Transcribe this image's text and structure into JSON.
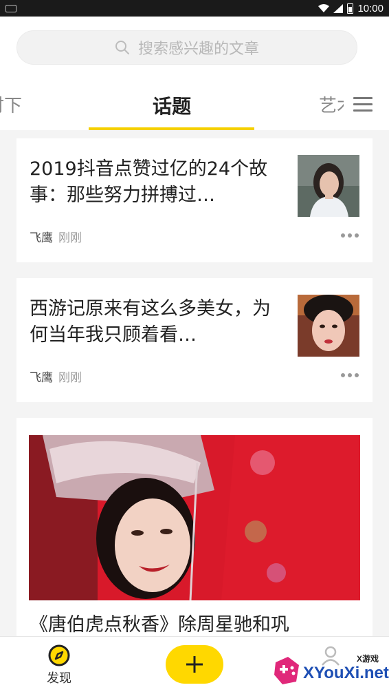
{
  "status_bar": {
    "time": "10:00"
  },
  "search": {
    "placeholder": "搜索感兴趣的文章"
  },
  "tabs": {
    "left_partial": "时下",
    "active": "话题",
    "right_partial": "艺术"
  },
  "articles": [
    {
      "title": "2019抖音点赞过亿的24个故事：那些努力拼搏过…",
      "author": "飞鹰",
      "time": "刚刚"
    },
    {
      "title": "西游记原来有这么多美女，为何当年我只顾着看…",
      "author": "飞鹰",
      "time": "刚刚"
    },
    {
      "title": "《唐伯虎点秋香》除周星驰和巩"
    }
  ],
  "bottom_nav": {
    "discover_label": "发现"
  },
  "watermark": {
    "small_text": "X游戏",
    "text": "XYouXi.net"
  },
  "colors": {
    "accent": "#ffd800",
    "underline": "#f5d000",
    "watermark_blue": "#1e4fb4"
  }
}
